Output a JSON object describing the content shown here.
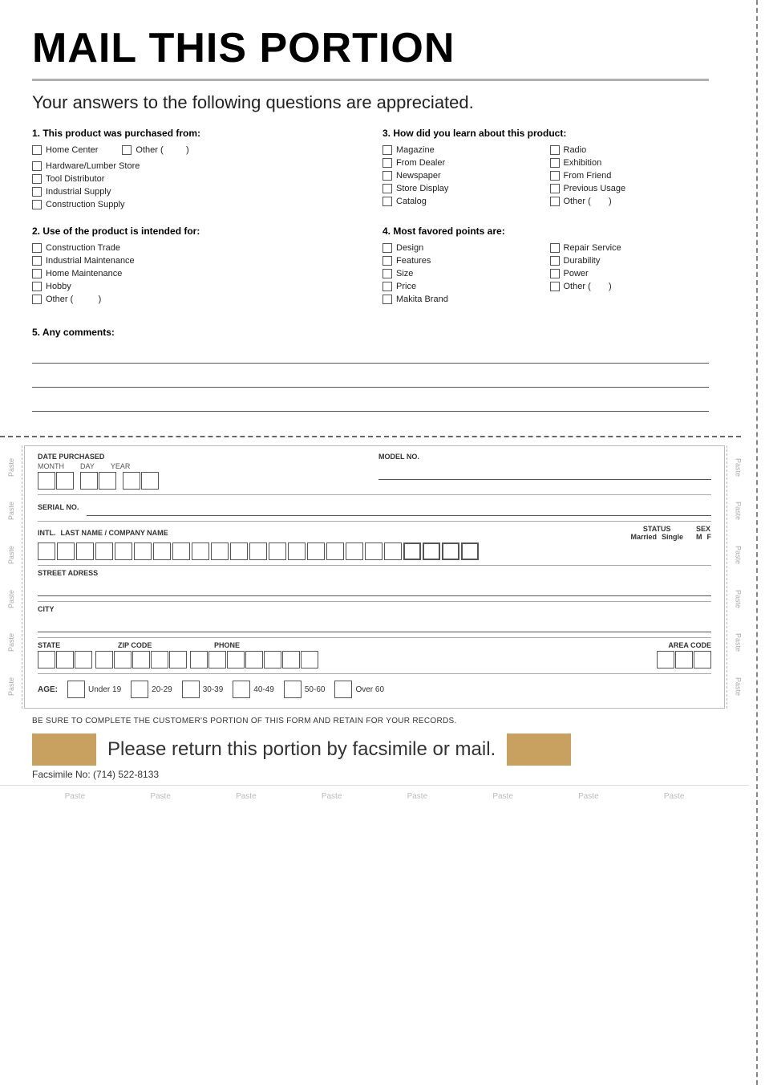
{
  "title": "MAIL THIS PORTION",
  "subtitle": "Your answers to the following questions are appreciated.",
  "questions": {
    "q1": {
      "label": "1. This product was purchased from:",
      "options": [
        {
          "text": "Home Center"
        },
        {
          "text": "Other (",
          "paren": ")"
        },
        {
          "text": "Hardware/Lumber Store"
        },
        {
          "text": "Tool Distributor"
        },
        {
          "text": "Industrial Supply"
        },
        {
          "text": "Construction Supply"
        }
      ]
    },
    "q2": {
      "label": "2. Use of the product is intended for:",
      "options": [
        {
          "text": "Construction Trade"
        },
        {
          "text": "Industrial Maintenance"
        },
        {
          "text": "Home Maintenance"
        },
        {
          "text": "Hobby"
        },
        {
          "text": "Other (",
          "paren": ")"
        }
      ]
    },
    "q3": {
      "label": "3. How did you learn about this product:",
      "options_col1": [
        {
          "text": "Magazine"
        },
        {
          "text": "From Dealer"
        },
        {
          "text": "Newspaper"
        },
        {
          "text": "Store Display"
        },
        {
          "text": "Catalog"
        }
      ],
      "options_col2": [
        {
          "text": "Radio"
        },
        {
          "text": "Exhibition"
        },
        {
          "text": "From Friend"
        },
        {
          "text": "Previous Usage"
        },
        {
          "text": "Other (",
          "paren": ")"
        }
      ]
    },
    "q4": {
      "label": "4. Most favored points are:",
      "options_col1": [
        {
          "text": "Design"
        },
        {
          "text": "Features"
        },
        {
          "text": "Size"
        },
        {
          "text": "Price"
        },
        {
          "text": "Makita Brand"
        }
      ],
      "options_col2": [
        {
          "text": "Repair Service"
        },
        {
          "text": "Durability"
        },
        {
          "text": "Power"
        },
        {
          "text": "Other (",
          "paren": ")"
        }
      ]
    },
    "q5": {
      "label": "5. Any comments:"
    }
  },
  "form": {
    "date_purchased_label": "DATE PURCHASED",
    "month_label": "MONTH",
    "day_label": "DAY",
    "year_label": "YEAR",
    "model_no_label": "MODEL NO.",
    "serial_no_label": "SERIAL NO.",
    "intl_label": "INTL.",
    "last_name_label": "LAST NAME / COMPANY NAME",
    "status_label": "STATUS",
    "married_label": "Married",
    "single_label": "Single",
    "sex_label": "SEX",
    "m_label": "M",
    "f_label": "F",
    "street_label": "STREET ADRESS",
    "city_label": "CITY",
    "state_label": "STATE",
    "zip_label": "ZIP CODE",
    "phone_label": "PHONE",
    "area_code_label": "AREA CODE",
    "age_label": "AGE:",
    "age_options": [
      {
        "text": "Under 19"
      },
      {
        "text": "20-29"
      },
      {
        "text": "30-39"
      },
      {
        "text": "40-49"
      },
      {
        "text": "50-60"
      },
      {
        "text": "Over 60"
      }
    ]
  },
  "bottom": {
    "retain_text": "BE SURE TO COMPLETE THE CUSTOMER'S PORTION OF THIS FORM AND RETAIN FOR YOUR RECORDS.",
    "return_text": "Please return this portion by facsimile or mail.",
    "fax_text": "Facsimile No: (714) 522-8133"
  },
  "paste_labels": [
    "Paste",
    "Paste",
    "Paste",
    "Paste",
    "Paste",
    "Paste",
    "Paste",
    "Paste"
  ],
  "side_paste_labels": [
    "Paste",
    "Paste",
    "Paste",
    "Paste",
    "Paste",
    "Paste"
  ]
}
